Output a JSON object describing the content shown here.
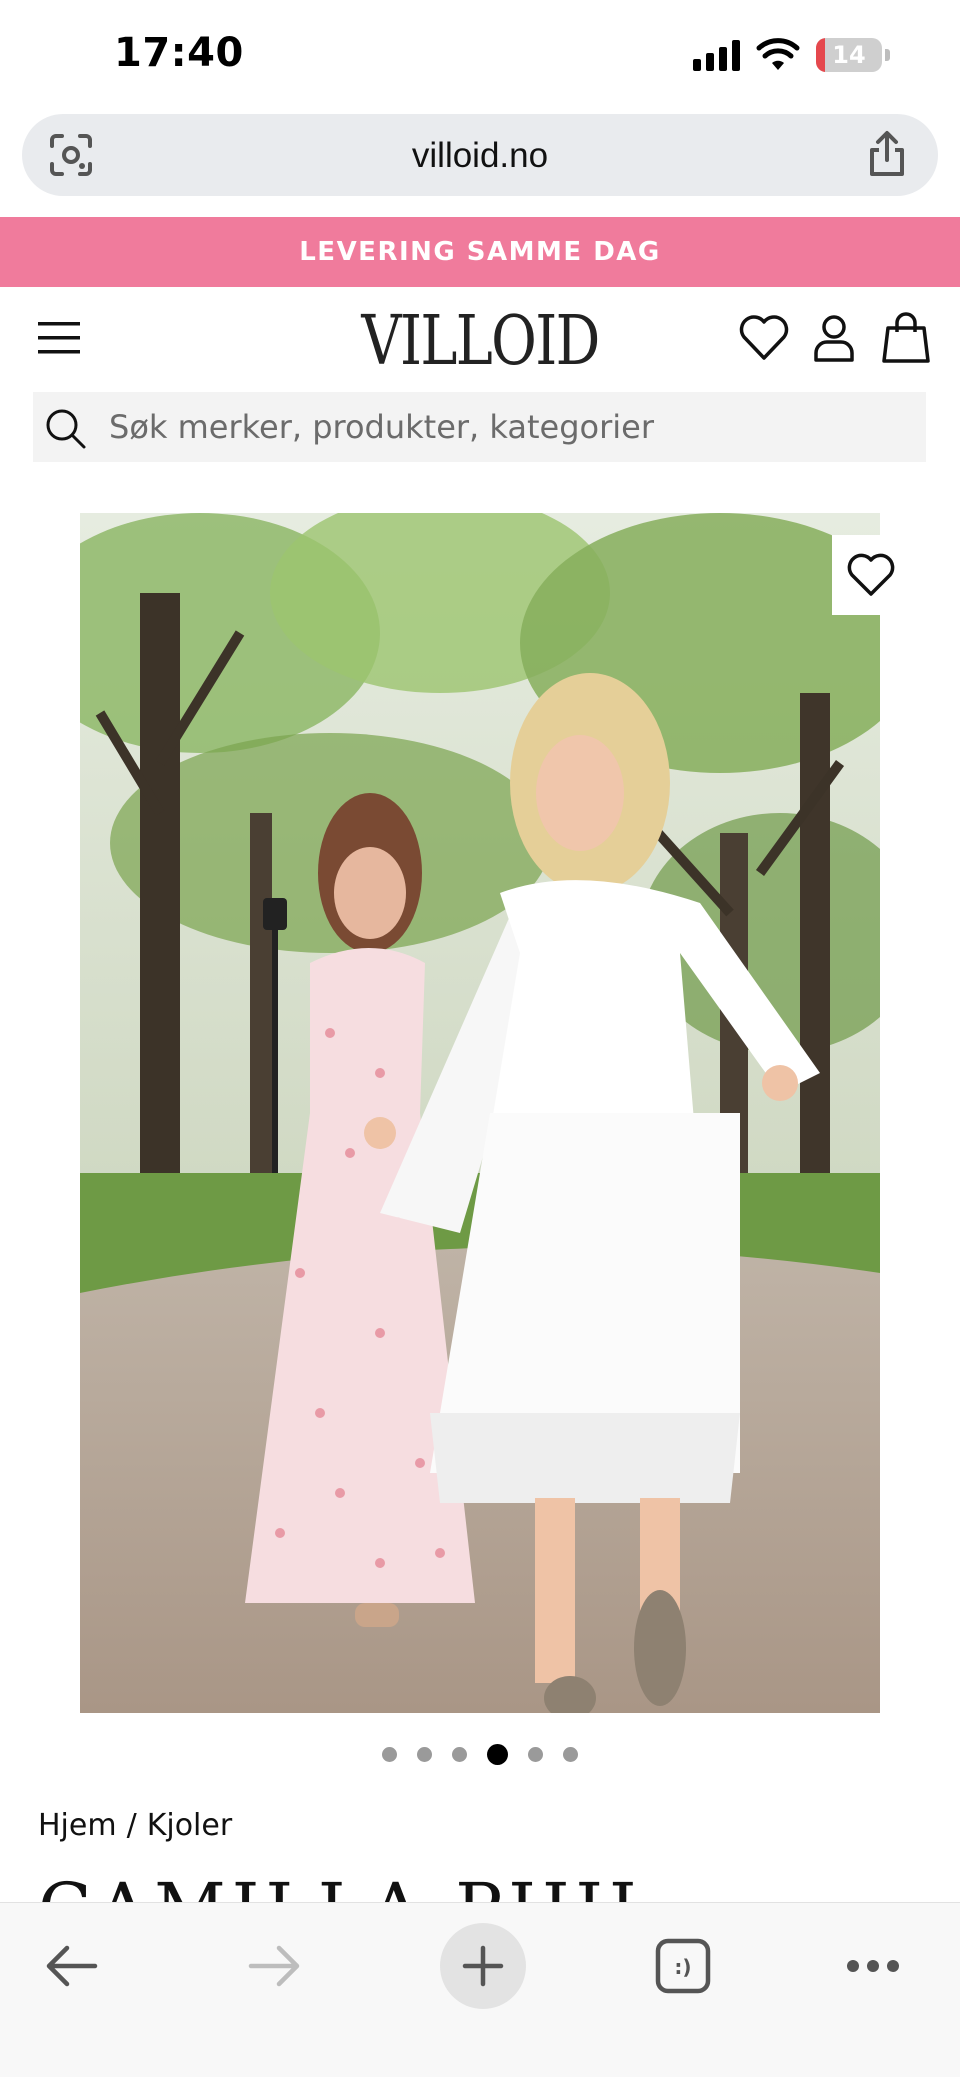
{
  "status_bar": {
    "time": "17:40",
    "battery": "14",
    "battery_fraction": 0.14,
    "icons": [
      "cellular-signal-icon",
      "wifi-icon",
      "battery-icon"
    ]
  },
  "browser": {
    "url": "villoid.no",
    "left_icon": "page-scan-icon",
    "right_icon": "share-icon"
  },
  "promo": {
    "text": "LEVERING SAMME DAG",
    "color": "#f07b9c"
  },
  "header": {
    "logo": "VILLOID",
    "icons": [
      "hamburger-menu-icon",
      "heart-icon",
      "user-icon",
      "shopping-bag-icon"
    ]
  },
  "search": {
    "placeholder": "Søk merker, produkter, kategorier"
  },
  "product": {
    "image_alt": "Two women walking in a park wearing dresses",
    "carousel": {
      "total": 6,
      "active_index": 3
    }
  },
  "breadcrumb": {
    "home": "Hjem",
    "separator": "/",
    "category": "Kjoler"
  },
  "product_title_partial": "CAMILLA PIHL",
  "toolbar": {
    "icons": [
      "back-arrow-icon",
      "forward-arrow-icon",
      "plus-icon",
      "tabs-icon",
      "more-icon"
    ],
    "tabs_label": ":)"
  }
}
